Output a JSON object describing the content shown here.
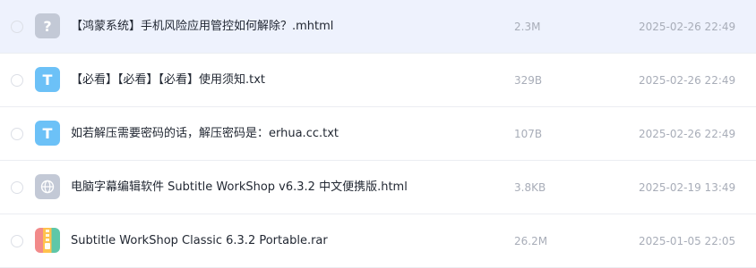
{
  "files": [
    {
      "icon": "unknown-file-icon",
      "icon_glyph": "?",
      "name": "【鸿蒙系统】手机风险应用管控如何解除？.mhtml",
      "size": "2.3M",
      "date": "2025-02-26 22:49",
      "selected": true
    },
    {
      "icon": "txt-file-icon",
      "icon_glyph": "T",
      "name": "【必看】【必看】【必看】使用须知.txt",
      "size": "329B",
      "date": "2025-02-26 22:49",
      "selected": false
    },
    {
      "icon": "txt-file-icon",
      "icon_glyph": "T",
      "name": "如若解压需要密码的话，解压密码是：erhua.cc.txt",
      "size": "107B",
      "date": "2025-02-26 22:49",
      "selected": false
    },
    {
      "icon": "html-file-icon",
      "icon_glyph": "",
      "name": "电脑字幕编辑软件 Subtitle WorkShop v6.3.2 中文便携版.html",
      "size": "3.8KB",
      "date": "2025-02-19 13:49",
      "selected": false
    },
    {
      "icon": "rar-archive-icon",
      "icon_glyph": "",
      "name": "Subtitle WorkShop Classic 6.3.2 Portable.rar",
      "size": "26.2M",
      "date": "2025-01-05 22:05",
      "selected": false
    }
  ],
  "colors": {
    "selected_row_bg": "#eef2fd",
    "txt_icon": "#6cc1f7",
    "generic_icon": "#c3c9d6",
    "meta_text": "#a8adb8",
    "name_text": "#222833"
  }
}
